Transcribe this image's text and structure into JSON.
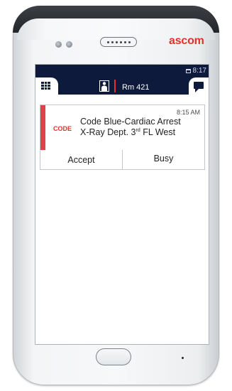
{
  "device": {
    "brand": "ascom"
  },
  "status_bar": {
    "time": "8:17"
  },
  "header": {
    "room": "Rm 421",
    "left_tab_icon": "grid-menu-icon",
    "right_tab_icon": "chat-bubble-icon",
    "patient_icon": "patient-icon",
    "accent_color": "#e4322b",
    "bar_color": "#0d1a3c"
  },
  "alarm": {
    "time": "8:15 AM",
    "type_label": "CODE",
    "title": "Code Blue-Cardiac Arrest",
    "location_prefix": "X-Ray Dept. 3",
    "location_sup": "rd",
    "location_suffix": " FL West",
    "stripe_color": "#e0424b"
  },
  "actions": {
    "accept_label": "Accept",
    "busy_label": "Busy"
  }
}
